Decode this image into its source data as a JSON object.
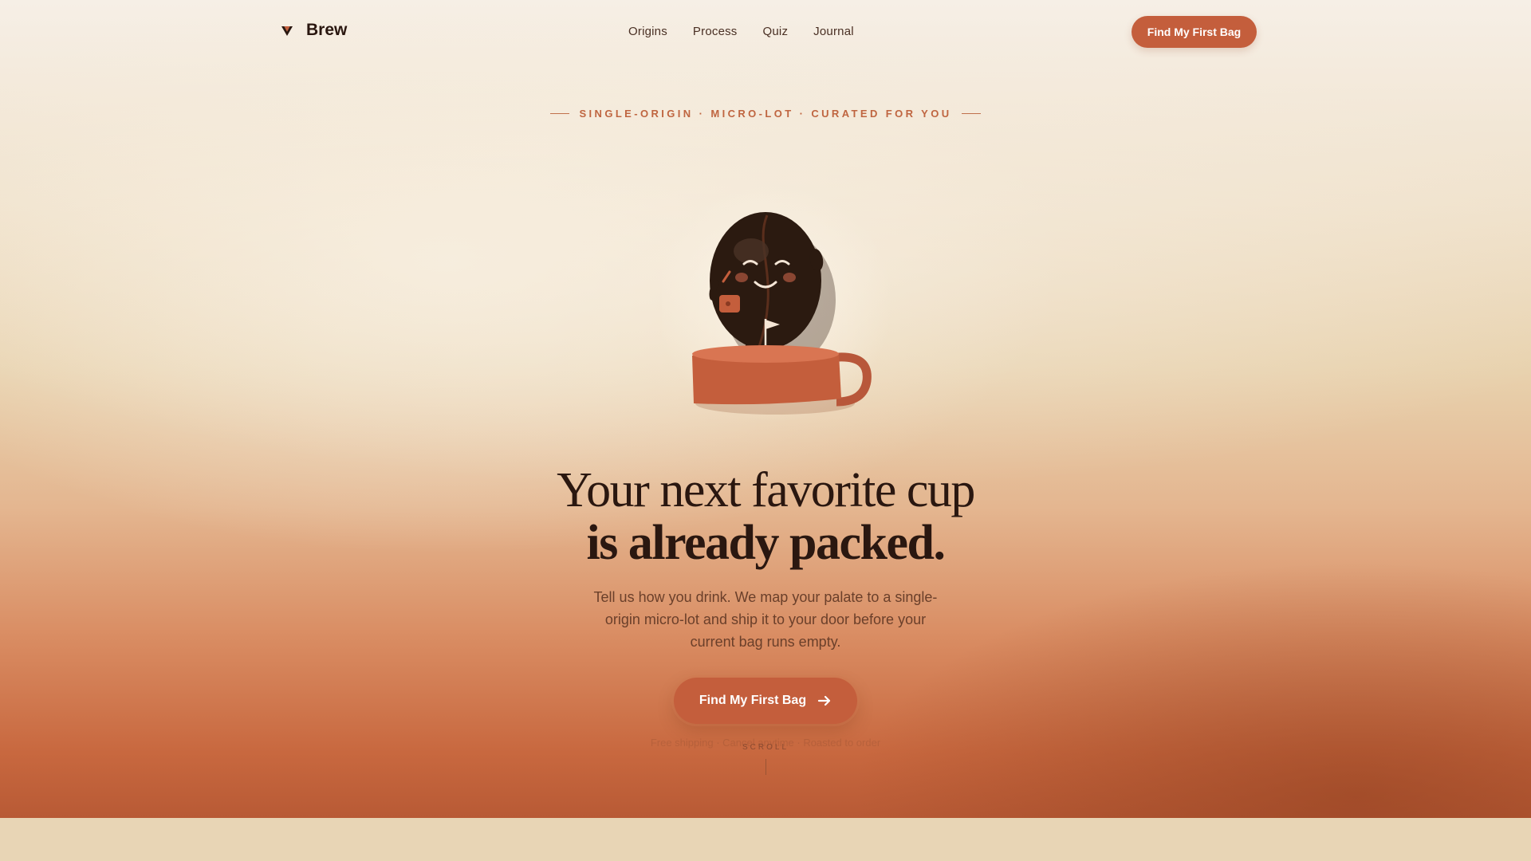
{
  "nav": {
    "brand": "Brew",
    "links": [
      "Origins",
      "Process",
      "Quiz",
      "Journal"
    ],
    "cta_label": "Find My First Bag"
  },
  "hero": {
    "eyebrow": "SINGLE-ORIGIN · MICRO-LOT · CURATED FOR YOU",
    "headline_line1": "Your next favorite cup",
    "headline_line2": "is already packed.",
    "subtext": "Tell us how you drink. We map your palate to a single-origin micro-lot and ship it to your door before your current bag runs empty.",
    "cta_label": "Find My First Bag",
    "fine_print": "Free shipping · Cancel anytime · Roasted to order",
    "scroll_label": "SCROLL"
  },
  "colors": {
    "accent": "#c45e3c",
    "ink": "#2a1710",
    "eyebrow": "#bf6540"
  },
  "icons": {
    "logo": "brew-logo-icon",
    "cta_arrow": "arrow-right-icon",
    "mascot": "coffee-bean-mascot"
  }
}
